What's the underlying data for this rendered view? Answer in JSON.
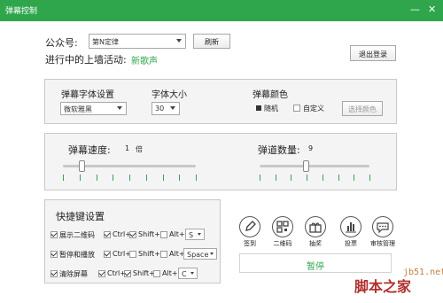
{
  "window": {
    "title": "弹幕控制",
    "min": "—",
    "close": "✕"
  },
  "account": {
    "label": "公众号:",
    "value": "第N定律",
    "refresh": "刷新"
  },
  "activity": {
    "label": "进行中的上墙活动:",
    "value": "新歌声",
    "logout": "退出登录"
  },
  "settings": {
    "font_label": "弹幕字体设置",
    "font_value": "微软雅黑",
    "size_label": "字体大小",
    "size_value": "30",
    "color_label": "弹幕颜色",
    "random": "随机",
    "custom": "自定义",
    "pick_color": "选择颜色"
  },
  "sliders": {
    "speed_label": "弹幕速度:",
    "speed_value": "1",
    "speed_unit": "倍",
    "speed_level": 0.14,
    "lane_label": "弹道数量:",
    "lane_value": "9",
    "lane_level": 0.42
  },
  "hotkeys": {
    "title": "快捷键设置",
    "rows": [
      {
        "label": "展示二维码",
        "ctrl": "Ctrl+",
        "shift": "Shift+",
        "alt": "Alt+",
        "key": "S"
      },
      {
        "label": "暂停和播放",
        "ctrl": "Ctrl+",
        "shift": "Shift+",
        "alt": "Alt+",
        "key": "Space"
      },
      {
        "label": "清除屏幕",
        "ctrl": "Ctrl+",
        "shift": "Shift+",
        "alt": "Alt+",
        "key": "C"
      }
    ]
  },
  "tools": [
    "签到",
    "二维码",
    "抽奖",
    "投票",
    "审核管理"
  ],
  "pause": "暂停",
  "watermark": {
    "site": "jb51.net",
    "name": "脚本之家"
  }
}
